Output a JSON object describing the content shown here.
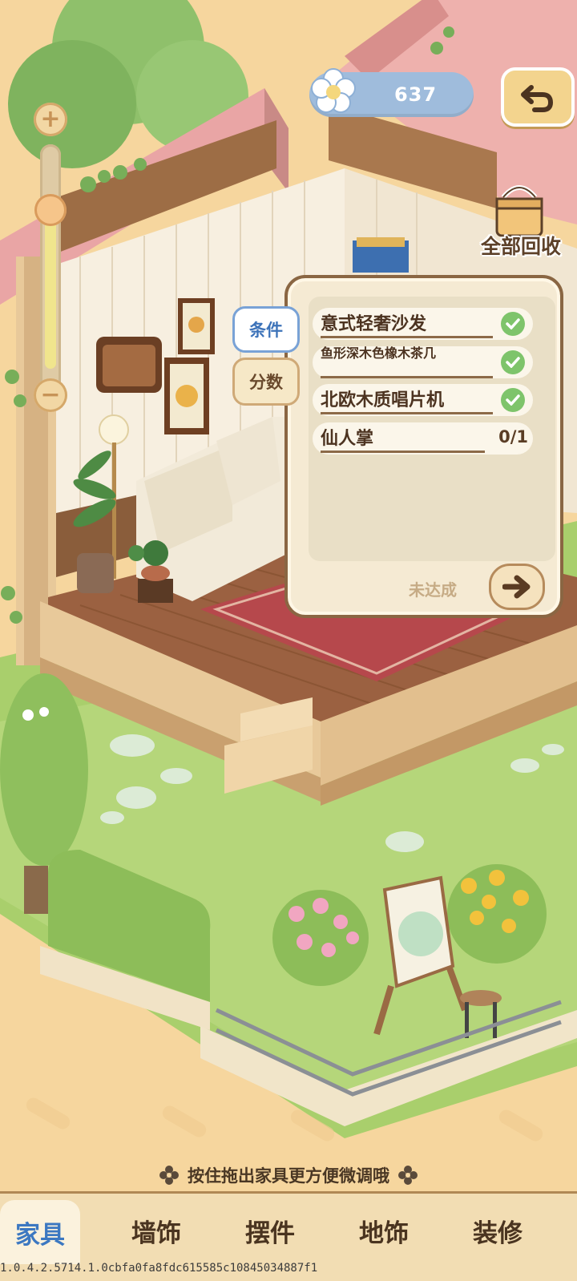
{
  "currency": {
    "amount": "637",
    "icon": "flower-icon"
  },
  "top": {
    "back_icon": "undo-arrow-icon",
    "recycle_label": "全部回收",
    "recycle_icon": "box-basket-icon"
  },
  "zoom": {
    "plus": "+",
    "minus": "−",
    "level": 0.9
  },
  "quest": {
    "tabs": [
      {
        "label": "条件",
        "active": true
      },
      {
        "label": "分数",
        "active": false
      }
    ],
    "items": [
      {
        "name": "意式轻奢沙发",
        "done": true
      },
      {
        "name": "鱼形深木色橡木茶几",
        "done": true
      },
      {
        "name": "北欧木质唱片机",
        "done": true
      },
      {
        "name": "仙人掌",
        "done": false,
        "progress": "0/1"
      }
    ],
    "status": "未达成",
    "go_icon": "arrow-right-icon"
  },
  "hint": "按住拖出家具更方便微调哦",
  "tabs": [
    {
      "label": "家具",
      "active": true
    },
    {
      "label": "墙饰",
      "active": false
    },
    {
      "label": "摆件",
      "active": false
    },
    {
      "label": "地饰",
      "active": false
    },
    {
      "label": "装修",
      "active": false
    }
  ],
  "version": "1.0.4.2.5714.1.0cbfa0fa8fdc615585c10845034887f1",
  "colors": {
    "accent": "#3c78c1",
    "panel_border": "#8a6643",
    "check": "#7ec46b",
    "currency_bg": "#9fbcdc"
  }
}
